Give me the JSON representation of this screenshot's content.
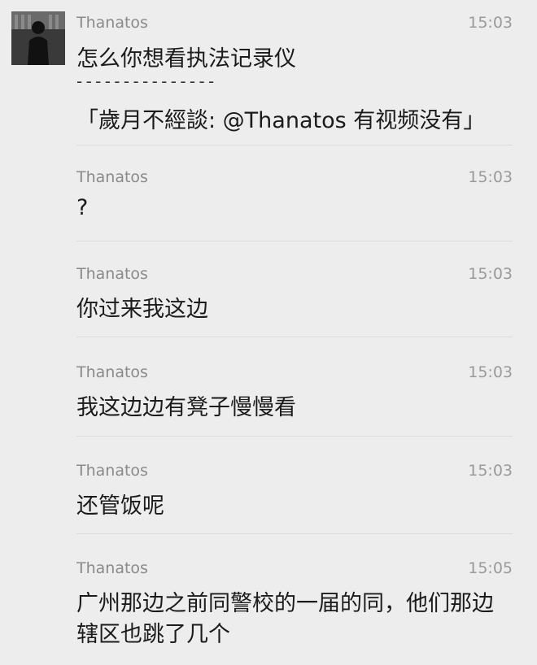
{
  "messages": [
    {
      "sender": "Thanatos",
      "time": "15:03",
      "lines": [
        "怎么你想看执法记录仪",
        "- - - - - - - - - - - - - - -",
        "「歲月不經談: @Thanatos 有视频没有」"
      ]
    },
    {
      "sender": "Thanatos",
      "time": "15:03",
      "lines": [
        "?"
      ]
    },
    {
      "sender": "Thanatos",
      "time": "15:03",
      "lines": [
        "你过来我这边"
      ]
    },
    {
      "sender": "Thanatos",
      "time": "15:03",
      "lines": [
        "我这边边有凳子慢慢看"
      ]
    },
    {
      "sender": "Thanatos",
      "time": "15:03",
      "lines": [
        "还管饭呢"
      ]
    },
    {
      "sender": "Thanatos",
      "time": "15:05",
      "lines": [
        "广州那边之前同警校的一届的同，他们那边",
        "辖区也跳了几个"
      ]
    }
  ]
}
